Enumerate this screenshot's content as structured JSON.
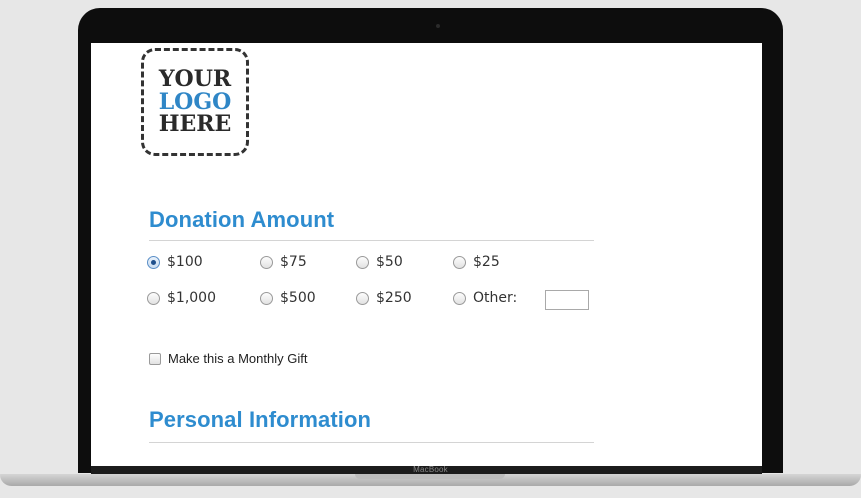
{
  "device": {
    "brand_label": "MacBook"
  },
  "logo": {
    "line1": "YOUR",
    "line2": "LOGO",
    "line3": "HERE"
  },
  "donation": {
    "title": "Donation Amount",
    "options": [
      {
        "label": "$100",
        "checked": true
      },
      {
        "label": "$75",
        "checked": false
      },
      {
        "label": "$50",
        "checked": false
      },
      {
        "label": "$25",
        "checked": false
      },
      {
        "label": "$1,000",
        "checked": false
      },
      {
        "label": "$500",
        "checked": false
      },
      {
        "label": "$250",
        "checked": false
      },
      {
        "label": "Other:",
        "checked": false
      }
    ],
    "other_value": ""
  },
  "monthly": {
    "label": "Make this a Monthly Gift",
    "checked": false
  },
  "personal": {
    "title": "Personal Information"
  },
  "colors": {
    "accent": "#2e8ccf",
    "logo_blue": "#2f86c6",
    "logo_text": "#2a2a2a"
  }
}
